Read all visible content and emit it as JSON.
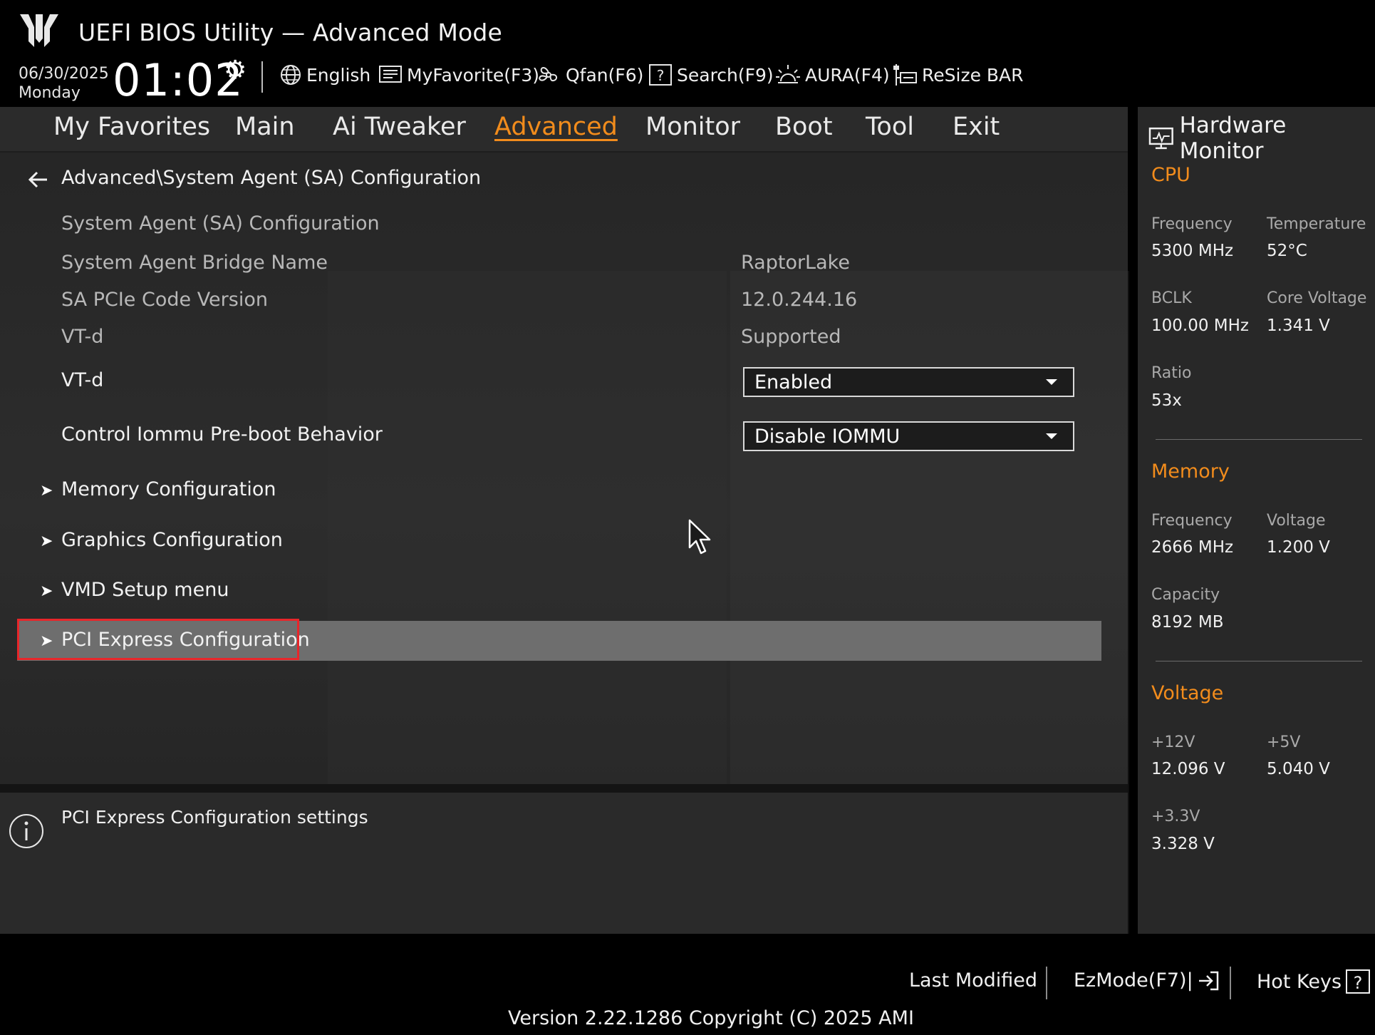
{
  "header": {
    "app_title": "UEFI BIOS Utility — Advanced Mode",
    "date": "06/30/2025",
    "day": "Monday",
    "time": "01:02",
    "toolbar": [
      {
        "icon": "globe-icon",
        "label": "English"
      },
      {
        "icon": "favorite-list-icon",
        "label": "MyFavorite(F3)"
      },
      {
        "icon": "fan-icon",
        "label": "Qfan(F6)"
      },
      {
        "icon": "help-box-icon",
        "label": "Search(F9)"
      },
      {
        "icon": "aura-icon",
        "label": "AURA(F4)"
      },
      {
        "icon": "resize-bar-icon",
        "label": "ReSize BAR"
      }
    ]
  },
  "tabs": [
    {
      "label": "My Favorites"
    },
    {
      "label": "Main"
    },
    {
      "label": "Ai Tweaker"
    },
    {
      "label": "Advanced",
      "active": true
    },
    {
      "label": "Monitor"
    },
    {
      "label": "Boot"
    },
    {
      "label": "Tool"
    },
    {
      "label": "Exit"
    }
  ],
  "breadcrumb": "Advanced\\System Agent (SA) Configuration",
  "settings": {
    "section_title": "System Agent (SA) Configuration",
    "bridge_label": "System Agent Bridge Name",
    "bridge_value": "RaptorLake",
    "pcie_code_label": "SA PCIe Code Version",
    "pcie_code_value": "12.0.244.16",
    "vtd_info_label": "VT-d",
    "vtd_info_value": "Supported",
    "vtd_label": "VT-d",
    "vtd_value": "Enabled",
    "iommu_label": "Control Iommu Pre-boot Behavior",
    "iommu_value": "Disable IOMMU"
  },
  "submenus": [
    {
      "label": "Memory Configuration"
    },
    {
      "label": "Graphics Configuration"
    },
    {
      "label": "VMD Setup menu"
    },
    {
      "label": "PCI Express Configuration",
      "selected": true
    }
  ],
  "help_text": "PCI Express Configuration settings",
  "hardware_monitor": {
    "title": "Hardware Monitor",
    "cpu": {
      "heading": "CPU",
      "frequency_label": "Frequency",
      "frequency": "5300 MHz",
      "temperature_label": "Temperature",
      "temperature": "52°C",
      "bclk_label": "BCLK",
      "bclk": "100.00 MHz",
      "core_voltage_label": "Core Voltage",
      "core_voltage": "1.341 V",
      "ratio_label": "Ratio",
      "ratio": "53x"
    },
    "memory": {
      "heading": "Memory",
      "frequency_label": "Frequency",
      "frequency": "2666 MHz",
      "voltage_label": "Voltage",
      "voltage": "1.200 V",
      "capacity_label": "Capacity",
      "capacity": "8192 MB"
    },
    "voltage": {
      "heading": "Voltage",
      "v12_label": "+12V",
      "v12": "12.096 V",
      "v5_label": "+5V",
      "v5": "5.040 V",
      "v33_label": "+3.3V",
      "v33": "3.328 V"
    }
  },
  "footer": {
    "last_modified": "Last Modified",
    "ezmode": "EzMode(F7)|",
    "hot_keys": "Hot Keys",
    "hot_keys_glyph": "?",
    "version": "Version 2.22.1286 Copyright (C) 2025 AMI"
  },
  "colors": {
    "accent": "#f28c1c",
    "selection_border": "#e8262a",
    "selected_row": "#6e6e6e"
  }
}
